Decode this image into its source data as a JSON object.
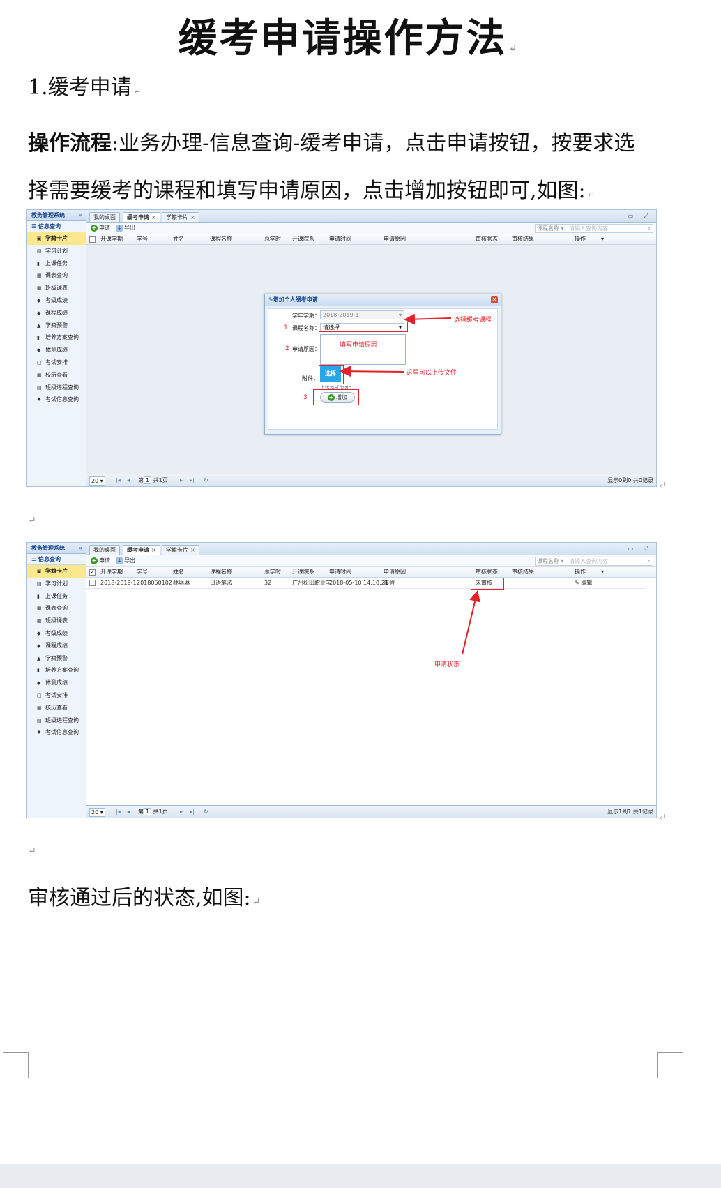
{
  "doc": {
    "title": "缓考申请操作方法",
    "heading": "1.缓考申请",
    "flow_label": "操作流程",
    "flow_text_1": ":业务办理-信息查询-缓考申请，点击申请按钮，按要求选",
    "flow_text_2": "择需要缓考的课程和填写申请原因，点击增加按钮即可,如图:",
    "after_text": "审核通过后的状态,如图:"
  },
  "app": {
    "system_name": "教务管理系统",
    "section": "信息查询",
    "menu": [
      {
        "label": "学籍卡片",
        "icon": "id-card-icon"
      },
      {
        "label": "学习计划",
        "icon": "plan-icon"
      },
      {
        "label": "上课任务",
        "icon": "book-icon"
      },
      {
        "label": "课表查询",
        "icon": "calendar-icon"
      },
      {
        "label": "班级课表",
        "icon": "calendar-icon"
      },
      {
        "label": "考级成绩",
        "icon": "cap-icon"
      },
      {
        "label": "课程成绩",
        "icon": "cap-icon"
      },
      {
        "label": "学籍预警",
        "icon": "warning-icon"
      },
      {
        "label": "培养方案查询",
        "icon": "book-icon"
      },
      {
        "label": "体测成绩",
        "icon": "cap-icon"
      },
      {
        "label": "考试安排",
        "icon": "window-icon"
      },
      {
        "label": "校历查看",
        "icon": "calendar-icon"
      },
      {
        "label": "班级进程查询",
        "icon": "list-icon"
      },
      {
        "label": "考试信息查询",
        "icon": "gear-icon"
      }
    ],
    "tabs": [
      "我的桌面",
      "缓考申请",
      "学籍卡片"
    ],
    "toolbar": {
      "apply": "申请",
      "export": "导出"
    },
    "search": {
      "field": "课程名称",
      "placeholder": "请输入查询内容"
    },
    "columns": [
      "开课学期",
      "学号",
      "姓名",
      "课程名称",
      "总学时",
      "开课院系",
      "申请时间",
      "申请原因",
      "审核状态",
      "审核结果",
      "操作"
    ],
    "pager": {
      "page_size": "20",
      "page_prefix": "第",
      "page_value": "1",
      "page_total": "共1页"
    },
    "pager_info_1": "显示0到0,共0记录",
    "pager_info_2": "显示1到1,共1记录"
  },
  "dialog": {
    "title": "增加个人缓考申请",
    "term_label": "学年学期：",
    "term_value": "2018-2019-1",
    "course_label": "课程名称：",
    "course_value": "请选择",
    "reason_label": "申请原因：",
    "attach_label": "附件：",
    "upload_btn": "选择",
    "upload_hint": "上传格式为zip",
    "add_btn": "增加",
    "step1": "1",
    "step2": "2",
    "step3": "3"
  },
  "annotations": {
    "select_course": "选择缓考课程",
    "fill_reason": "填写申请原因",
    "upload_file": "这里可以上传文件",
    "status": "申请状态"
  },
  "record": {
    "term": "2018-2019-1",
    "student_id": "2018050102",
    "name": "林琳琳",
    "course": "日语笔法",
    "hours": "32",
    "dept": "广州松田职业学",
    "time": "2018-05-10 14:10:21",
    "reason": "事假",
    "status": "未审核",
    "action": "编辑"
  },
  "colors": {
    "accent": "#15428b",
    "annotation": "#e8202a",
    "highlight": "#fbe78d"
  }
}
